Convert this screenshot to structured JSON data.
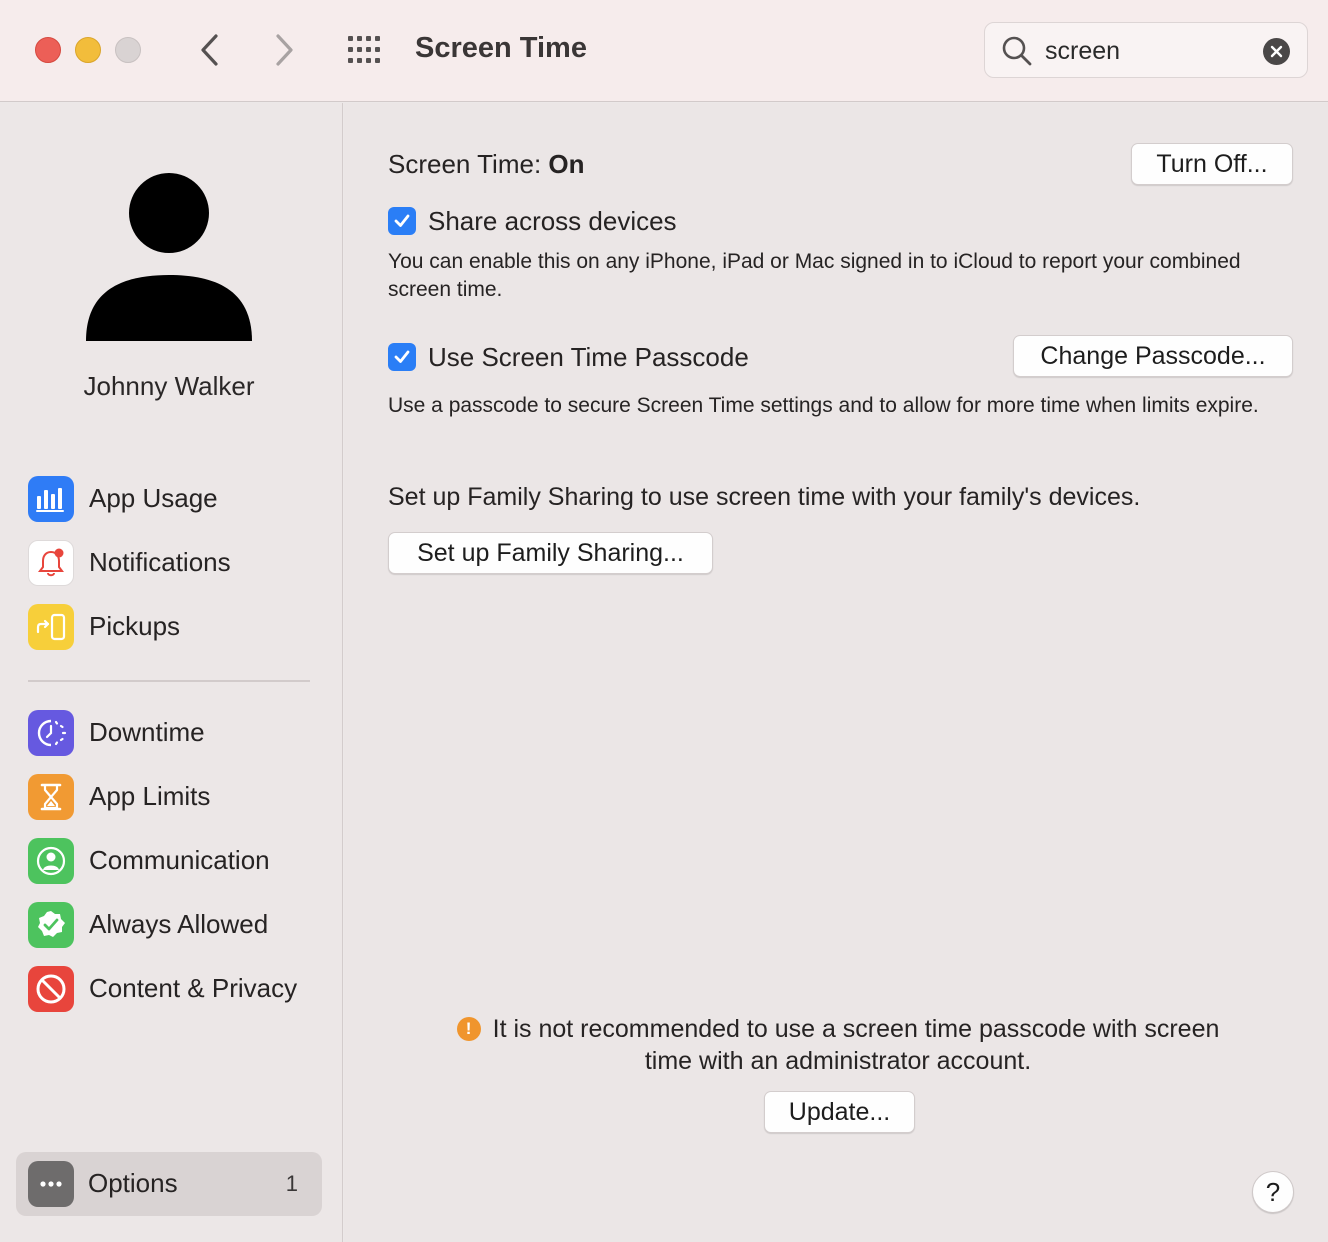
{
  "window": {
    "title": "Screen Time",
    "search": {
      "value": "screen",
      "placeholder": "Search"
    }
  },
  "sidebar": {
    "user_name": "Johnny Walker",
    "group1": [
      {
        "label": "App Usage",
        "icon": "bar-chart-icon",
        "color": "#2f7cf6"
      },
      {
        "label": "Notifications",
        "icon": "bell-icon",
        "color": "#ffffff"
      },
      {
        "label": "Pickups",
        "icon": "pickup-phone-icon",
        "color": "#f7cf3a"
      }
    ],
    "group2": [
      {
        "label": "Downtime",
        "icon": "downtime-icon",
        "color": "#6659e0"
      },
      {
        "label": "App Limits",
        "icon": "hourglass-icon",
        "color": "#f19a33"
      },
      {
        "label": "Communication",
        "icon": "person-circle-icon",
        "color": "#4dc35e"
      },
      {
        "label": "Always Allowed",
        "icon": "checkmark-seal-icon",
        "color": "#4dc35e"
      },
      {
        "label": "Content & Privacy",
        "icon": "no-entry-icon",
        "color": "#e8453c"
      }
    ],
    "options": {
      "label": "Options",
      "badge": "1",
      "icon": "ellipsis-icon"
    }
  },
  "main": {
    "status_prefix": "Screen Time:",
    "status_value": "On",
    "turn_off_button": "Turn Off...",
    "share": {
      "label": "Share across devices",
      "checked": true,
      "description": "You can enable this on any iPhone, iPad or Mac signed in to iCloud to report your combined screen time."
    },
    "passcode": {
      "label": "Use Screen Time Passcode",
      "checked": true,
      "button": "Change Passcode...",
      "description": "Use a passcode to secure Screen Time settings and to allow for more time when limits expire."
    },
    "family": {
      "text": "Set up Family Sharing to use screen time with your family's devices.",
      "button": "Set up Family Sharing..."
    },
    "warning": {
      "line1": "It is not recommended to use a screen time passcode with screen",
      "line2": "time with an administrator account.",
      "button": "Update..."
    },
    "help_button": "?"
  },
  "colors": {
    "accent": "#2a7ef6",
    "warning": "#f0952d",
    "close": "#ec5f57",
    "minimize": "#f2bd3b"
  }
}
